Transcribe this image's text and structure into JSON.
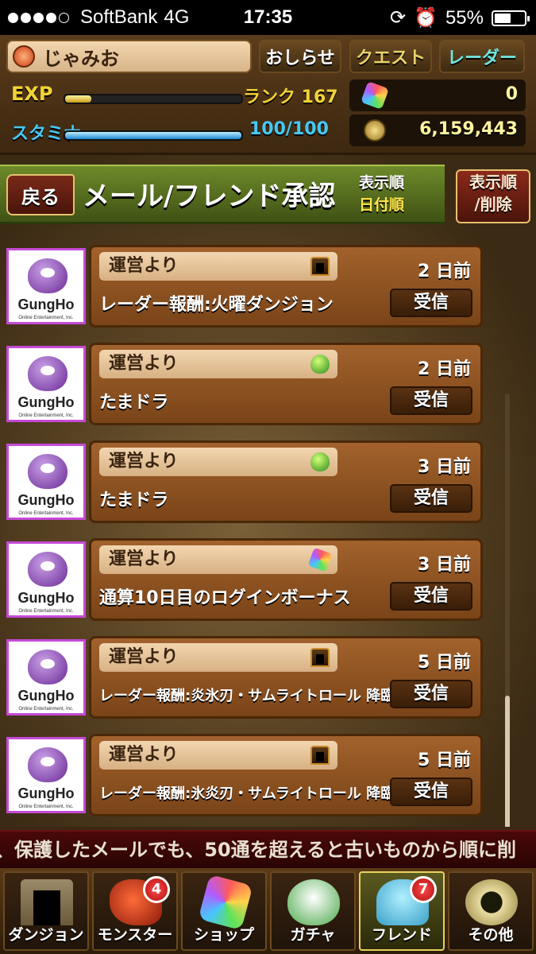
{
  "status_bar": {
    "carrier": "SoftBank",
    "network": "4G",
    "time": "17:35",
    "battery": "55%",
    "battery_level": 0.55,
    "signal_bars": 4
  },
  "header": {
    "player_name": "じゃみお",
    "news_button": "おしらせ",
    "quest_button": "クエスト",
    "radar_button": "レーダー",
    "exp_label": "EXP",
    "exp_fill": 0.15,
    "rank": "ランク 167",
    "stamina_label": "スタミナ",
    "stamina_fill": 1.0,
    "stamina": "100/100",
    "magic_stones": "0",
    "coins": "6,159,443"
  },
  "title_bar": {
    "back": "戻る",
    "title": "メール/フレンド承認",
    "sort_label": "表示順",
    "sort_value": "日付順",
    "sort_delete": [
      "表示順",
      "/削除"
    ]
  },
  "mails": [
    {
      "sender": "運営より",
      "reward_icon": "dungeon-door-icon",
      "days": "2 日前",
      "subject": "レーダー報酬:火曜ダンジョン",
      "action": "受信"
    },
    {
      "sender": "運営より",
      "reward_icon": "egg-icon",
      "days": "2 日前",
      "subject": "たまドラ",
      "action": "受信"
    },
    {
      "sender": "運営より",
      "reward_icon": "egg-icon",
      "days": "3 日前",
      "subject": "たまドラ",
      "action": "受信"
    },
    {
      "sender": "運営より",
      "reward_icon": "magic-stone-icon",
      "days": "3 日前",
      "subject": "通算10日目のログインボーナス",
      "action": "受信"
    },
    {
      "sender": "運営より",
      "reward_icon": "dungeon-door-icon",
      "days": "5 日前",
      "subject": "レーダー報酬:炎氷刃・サムライトロール 降臨!",
      "action": "受信"
    },
    {
      "sender": "運営より",
      "reward_icon": "dungeon-door-icon",
      "days": "5 日前",
      "subject": "レーダー報酬:氷炎刃・サムライトロール 降臨!",
      "action": "受信"
    }
  ],
  "avatar": {
    "brand": "GungHo",
    "sub": "Online Entertainment, Inc."
  },
  "ticker": "、保護したメールでも、50通を超えると古いものから順に削",
  "nav": [
    {
      "label": "ダンジョン",
      "badge": ""
    },
    {
      "label": "モンスター",
      "badge": "4"
    },
    {
      "label": "ショップ",
      "badge": ""
    },
    {
      "label": "ガチャ",
      "badge": ""
    },
    {
      "label": "フレンド",
      "badge": "7"
    },
    {
      "label": "その他",
      "badge": ""
    }
  ]
}
